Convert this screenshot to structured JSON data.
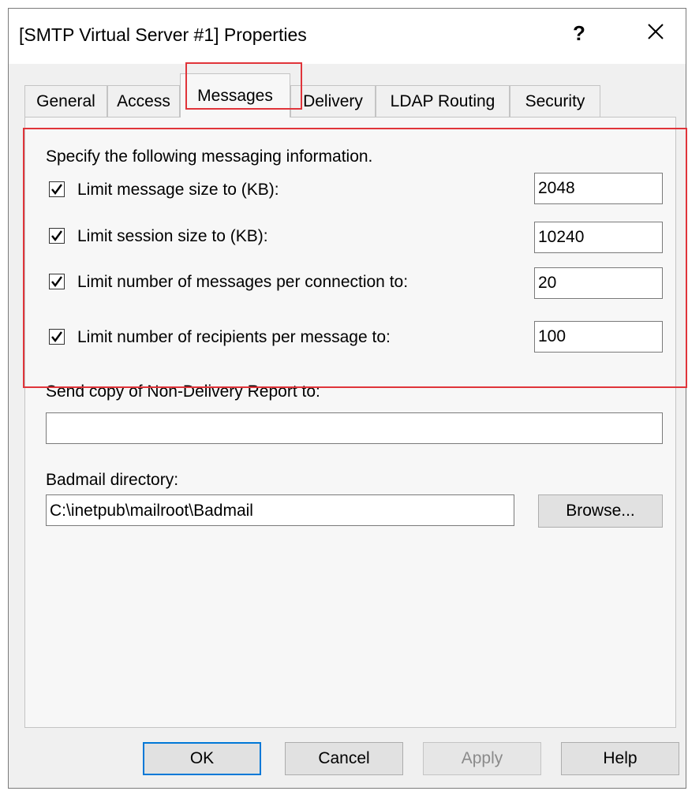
{
  "window": {
    "title": "[SMTP Virtual Server #1] Properties",
    "help_glyph": "?"
  },
  "tabs": [
    {
      "label": "General"
    },
    {
      "label": "Access"
    },
    {
      "label": "Messages",
      "selected": true
    },
    {
      "label": "Delivery"
    },
    {
      "label": "LDAP Routing"
    },
    {
      "label": "Security"
    }
  ],
  "messages": {
    "heading": "Specify the following messaging information.",
    "limits": [
      {
        "label": "Limit message size to (KB):",
        "checked": true,
        "value": "2048"
      },
      {
        "label": "Limit session size to (KB):",
        "checked": true,
        "value": "10240"
      },
      {
        "label": "Limit number of messages per connection to:",
        "checked": true,
        "value": "20"
      },
      {
        "label": "Limit number of recipients per message to:",
        "checked": true,
        "value": "100"
      }
    ],
    "ndr_label": "Send copy of Non-Delivery Report to:",
    "ndr_value": "",
    "badmail_label": "Badmail directory:",
    "badmail_value": "C:\\inetpub\\mailroot\\Badmail",
    "browse_label": "Browse..."
  },
  "buttons": {
    "ok": "OK",
    "cancel": "Cancel",
    "apply": "Apply",
    "help": "Help"
  },
  "colors": {
    "highlight": "#e0343a",
    "default_button_border": "#0078d7",
    "dialog_bg": "#f0f0f0"
  }
}
